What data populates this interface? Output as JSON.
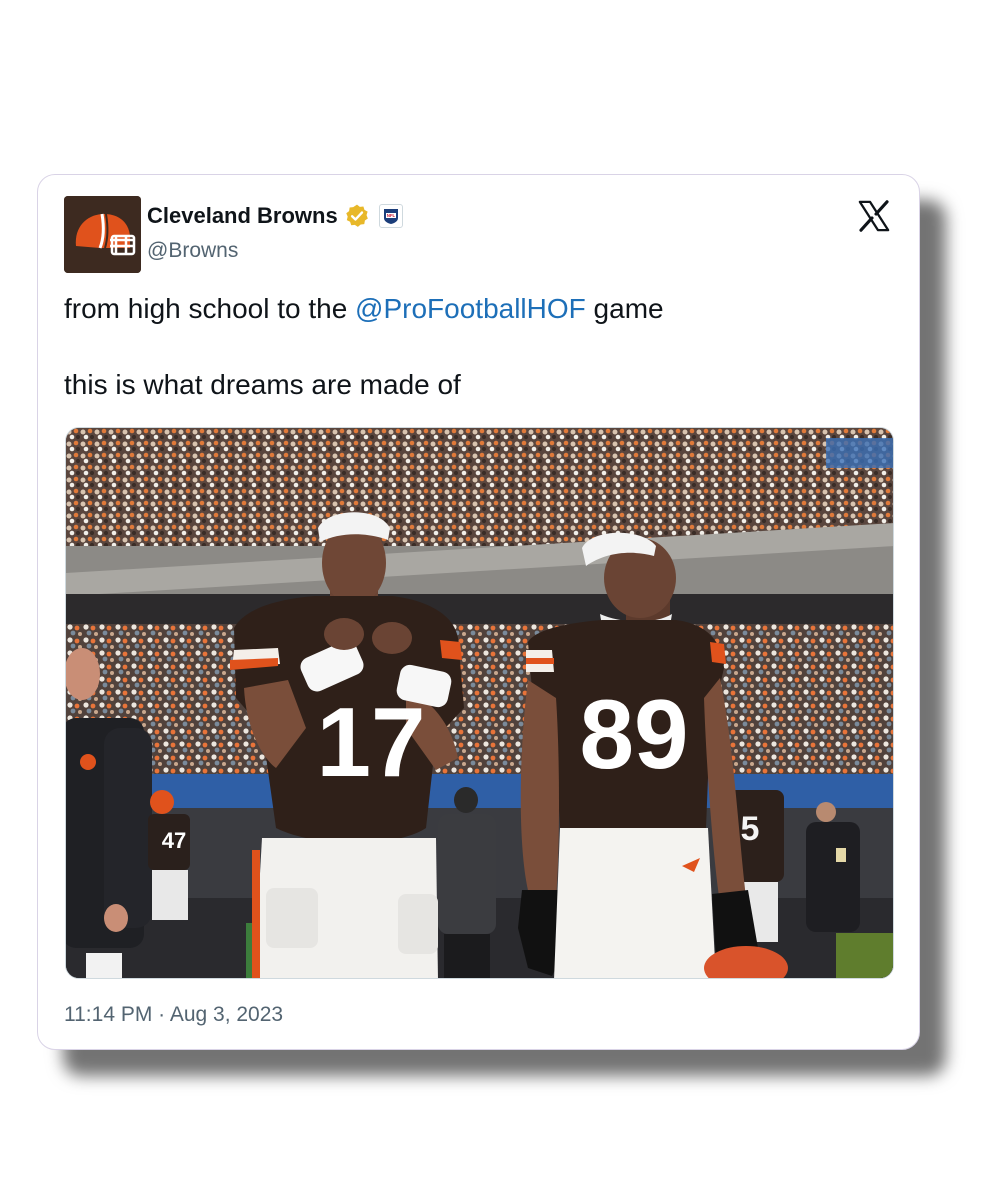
{
  "tweet": {
    "author_name": "Cleveland Browns",
    "handle": "@Browns",
    "text_before": "from high school to the ",
    "mention": "@ProFootballHOF",
    "text_after": " game",
    "text_line2": "this is what dreams are made of",
    "timestamp": "11:14 PM · Aug 3, 2023",
    "photo": {
      "jersey_left": "17",
      "jersey_right": "89",
      "sideline_jersey": "47",
      "background_jersey": "5"
    }
  },
  "icons": {
    "avatar": "browns-helmet-icon",
    "verified": "verified-gold-badge-icon",
    "affiliation": "nfl-logo-icon",
    "platform": "x-logo-icon"
  },
  "colors": {
    "link": "#1d6fb8",
    "browns_brown": "#3d2a20",
    "browns_orange": "#e0521c",
    "verified_gold": "#e8b829"
  }
}
